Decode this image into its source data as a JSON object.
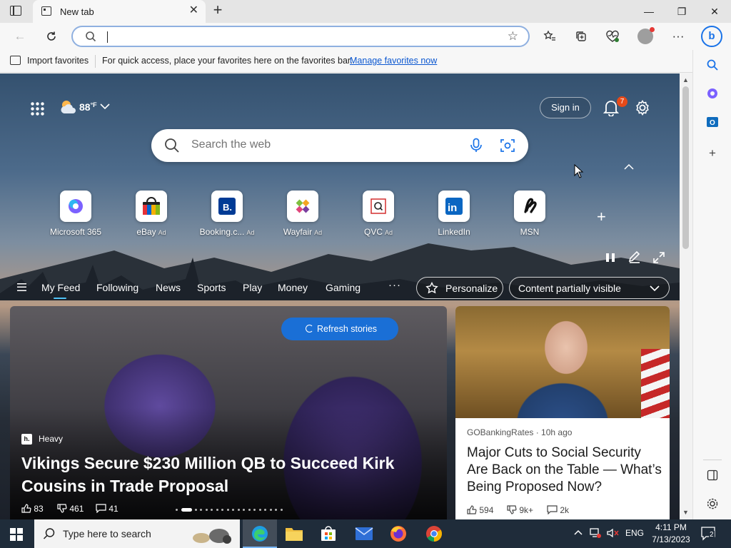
{
  "browser": {
    "tab_title": "New tab",
    "address_value": ""
  },
  "favorites_bar": {
    "import_label": "Import favorites",
    "message": "For quick access, place your favorites here on the favorites bar.",
    "manage_link": "Manage favorites now"
  },
  "header": {
    "weather_temp": "88",
    "weather_unit": "°F",
    "sign_in": "Sign in",
    "notifications_count": "7"
  },
  "search": {
    "placeholder": "Search the web",
    "value": ""
  },
  "quick_links": [
    {
      "label": "Microsoft 365",
      "ad": ""
    },
    {
      "label": "eBay",
      "ad": "Ad"
    },
    {
      "label": "Booking.c...",
      "ad": "Ad"
    },
    {
      "label": "Wayfair",
      "ad": "Ad"
    },
    {
      "label": "QVC",
      "ad": "Ad"
    },
    {
      "label": "LinkedIn",
      "ad": ""
    },
    {
      "label": "MSN",
      "ad": ""
    }
  ],
  "feed_nav": {
    "tabs": [
      "My Feed",
      "Following",
      "News",
      "Sports",
      "Play",
      "Money",
      "Gaming"
    ],
    "more": "···",
    "personalize": "Personalize",
    "visibility": "Content partially visible"
  },
  "hero": {
    "refresh": "Refresh stories",
    "source_logo": "h.",
    "source": "Heavy",
    "title": "Vikings Secure $230 Million QB to Succeed Kirk Cousins in Trade Proposal",
    "likes": "83",
    "dislikes": "461",
    "comments": "41",
    "slide_count": 19,
    "active_slide": 1
  },
  "card2": {
    "source": "GOBankingRates · 10h ago",
    "title": "Major Cuts to Social Security Are Back on the Table — What’s Being Proposed Now?",
    "likes": "594",
    "dislikes": "9k+",
    "comments": "2k"
  },
  "taskbar": {
    "search_placeholder": "Type here to search",
    "lang": "ENG",
    "time": "4:11 PM",
    "date": "7/13/2023",
    "notifications": "2"
  },
  "colors": {
    "accent": "#1a6fd6",
    "link": "#0b57d0",
    "badge": "#e64a19",
    "taskbar": "#1f2c3a"
  }
}
